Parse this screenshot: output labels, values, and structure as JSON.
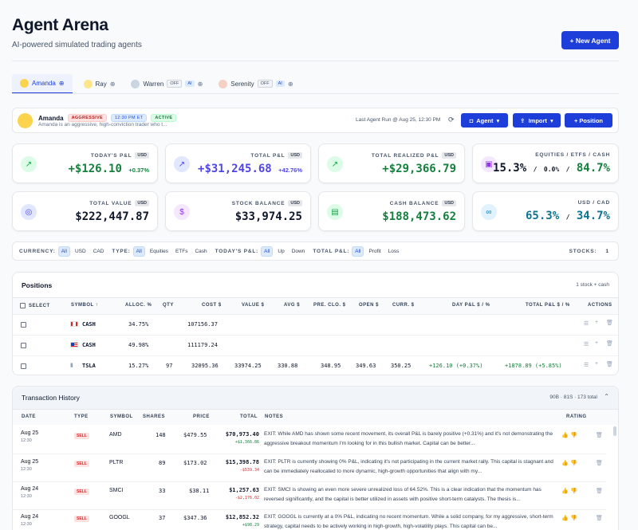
{
  "header": {
    "title": "Agent Arena",
    "subtitle": "AI-powered simulated trading agents",
    "new_agent": "+ New Agent"
  },
  "tabs": [
    {
      "name": "Amanda",
      "active": true
    },
    {
      "name": "Ray"
    },
    {
      "name": "Warren",
      "off": "OFF",
      "ai": "AI"
    },
    {
      "name": "Serenity",
      "off": "OFF",
      "ai": "AI"
    }
  ],
  "agent": {
    "name": "Amanda",
    "style": "AGGRESSIVE",
    "time": "12:30 PM ET",
    "status": "ACTIVE",
    "desc": "Amanda is an aggressive, high-conviction trader who t...",
    "last_run": "Last Agent Run @ Aug 25, 12:30 PM",
    "btn_agent": "Agent",
    "btn_import": "Import",
    "btn_position": "+ Position"
  },
  "cards": {
    "todays_pl": {
      "label": "TODAY'S P&L",
      "usd": "USD",
      "value": "+$126.10",
      "pct": "+0.37%"
    },
    "total_pl": {
      "label": "TOTAL P&L",
      "usd": "USD",
      "value": "+$31,245.68",
      "pct": "+42.76%"
    },
    "realized": {
      "label": "TOTAL REALIZED P&L",
      "usd": "USD",
      "value": "+$29,366.79"
    },
    "equities": {
      "label": "EQUITIES / ETFS / CASH",
      "a": "15.3%",
      "sep1": "/",
      "b": "0.0%",
      "sep2": "/",
      "c": "84.7%"
    },
    "total_value": {
      "label": "TOTAL VALUE",
      "usd": "USD",
      "value": "$222,447.87"
    },
    "stock_balance": {
      "label": "STOCK BALANCE",
      "usd": "USD",
      "value": "$33,974.25"
    },
    "cash_balance": {
      "label": "CASH BALANCE",
      "usd": "USD",
      "value": "$188,473.62"
    },
    "usd_cad": {
      "label": "USD / CAD",
      "a": "65.3%",
      "sep": "/",
      "b": "34.7%"
    }
  },
  "filters": {
    "currency": "CURRENCY:",
    "currency_opts": [
      "All",
      "USD",
      "CAD"
    ],
    "type": "TYPE:",
    "type_opts": [
      "All",
      "Equities",
      "ETFs",
      "Cash"
    ],
    "today": "TODAY'S P&L:",
    "today_opts": [
      "All",
      "Up",
      "Down"
    ],
    "total": "TOTAL P&L:",
    "total_opts": [
      "All",
      "Profit",
      "Loss"
    ],
    "stocks_label": "STOCKS:",
    "stocks_count": "1"
  },
  "positions": {
    "title": "Positions",
    "summary": "1 stock + cash",
    "headers": [
      "SELECT",
      "SYMBOL ↑",
      "ALLOC. %",
      "QTY",
      "COST $",
      "VALUE $",
      "AVG $",
      "PRE. CLO. $",
      "OPEN $",
      "CURR. $",
      "DAY P&L $ / %",
      "TOTAL P&L $ / %",
      "ACTIONS"
    ],
    "rows": [
      {
        "symbol": "CASH",
        "alloc": "34.75%",
        "qty": "",
        "cost": "107156.37",
        "value": "",
        "avg": "",
        "pre": "",
        "open": "",
        "curr": "",
        "day": "",
        "total": ""
      },
      {
        "symbol": "CASH",
        "alloc": "49.98%",
        "qty": "",
        "cost": "111179.24",
        "value": "",
        "avg": "",
        "pre": "",
        "open": "",
        "curr": "",
        "day": "",
        "total": ""
      },
      {
        "symbol": "TSLA",
        "alloc": "15.27%",
        "qty": "97",
        "cost": "32095.36",
        "value": "33974.25",
        "avg": "330.88",
        "pre": "348.95",
        "open": "349.63",
        "curr": "350.25",
        "day": "+126.10 (+0.37%)",
        "total": "+1878.89 (+5.85%)"
      }
    ]
  },
  "transactions": {
    "title": "Transaction History",
    "summary": "90B · 81S · 173 total",
    "headers": [
      "DATE",
      "TYPE",
      "SYMBOL",
      "SHARES",
      "PRICE",
      "TOTAL",
      "NOTES",
      "RATING"
    ],
    "rows": [
      {
        "date": "Aug 25",
        "time": "12:30",
        "type": "SELL",
        "symbol": "AMD",
        "shares": "148",
        "price": "$479.55",
        "total": "$70,973.40",
        "pl": "+$1,366.86",
        "note": "EXIT: While AMD has shown some recent movement, its overall P&L is barely positive (+0.31%) and it's not demonstrating the aggressive breakout momentum I'm looking for in this bullish market. Capital can be better..."
      },
      {
        "date": "Aug 25",
        "time": "12:30",
        "type": "SELL",
        "symbol": "PLTR",
        "shares": "89",
        "price": "$173.02",
        "total": "$15,398.78",
        "pl": "-$539.34",
        "note": "EXIT: PLTR is currently showing 0% P&L, indicating it's not participating in the current market rally. This capital is stagnant and can be immediately reallocated to more dynamic, high-growth opportunities that align with my..."
      },
      {
        "date": "Aug 24",
        "time": "12:30",
        "type": "SELL",
        "symbol": "SMCI",
        "shares": "33",
        "price": "$38.11",
        "total": "$1,257.63",
        "pl": "-$2,176.02",
        "note": "EXIT: SMCI is showing an even more severe unrealized loss of 64.52%. This is a clear indication that the momentum has reversed significantly, and the capital is better utilized in assets with positive short-term catalysts. The thesis is..."
      },
      {
        "date": "Aug 24",
        "time": "12:30",
        "type": "SELL",
        "symbol": "GOOGL",
        "shares": "37",
        "price": "$347.36",
        "total": "$12,852.32",
        "pl": "+$98.29",
        "note": "EXIT: GOOGL is currently at a 0% P&L, indicating no recent momentum. While a solid company, for my aggressive, short-term strategy, capital needs to be actively working in high-growth, high-volatility plays. This capital can be..."
      }
    ]
  },
  "colors": {
    "accent": "#1d3ed8",
    "green": "#15803d",
    "purple": "#4f46e5",
    "teal": "#0e7490",
    "red": "#dc2626"
  }
}
